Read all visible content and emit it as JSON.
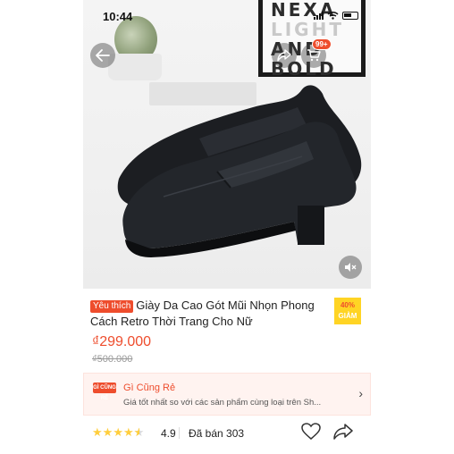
{
  "status_bar": {
    "time": "10:44"
  },
  "background_print": {
    "line1": "NEXA",
    "line2": "LIGHT",
    "line3": "AND",
    "line4": "BOLD"
  },
  "cart": {
    "badge": "99+"
  },
  "product": {
    "tag": "Yêu thích",
    "title": "Giày Da Cao Gót Mũi Nhọn Phong Cách Retro Thời Trang Cho Nữ",
    "discount_percent": "40%",
    "discount_label": "GIẢM",
    "price": "₫299.000",
    "original_price": "₫500.000"
  },
  "promo": {
    "logo_text": "GÌ CŨNG RẺ",
    "title": "Gì Cũng Rẻ",
    "subtitle": "Giá tốt nhất so với các sản phẩm cùng loại trên Sh..."
  },
  "rating": {
    "stars": 4.9,
    "value": "4.9",
    "sold": "Đã bán 303"
  },
  "icons": [
    "back-arrow-icon",
    "share-icon",
    "cart-icon",
    "mute-icon",
    "chevron-right-icon",
    "star-icon",
    "heart-icon",
    "share-arrow-icon"
  ],
  "colors": {
    "accent": "#ee4d2d",
    "discount_bg": "#ffd424",
    "star": "#ffce3d"
  }
}
